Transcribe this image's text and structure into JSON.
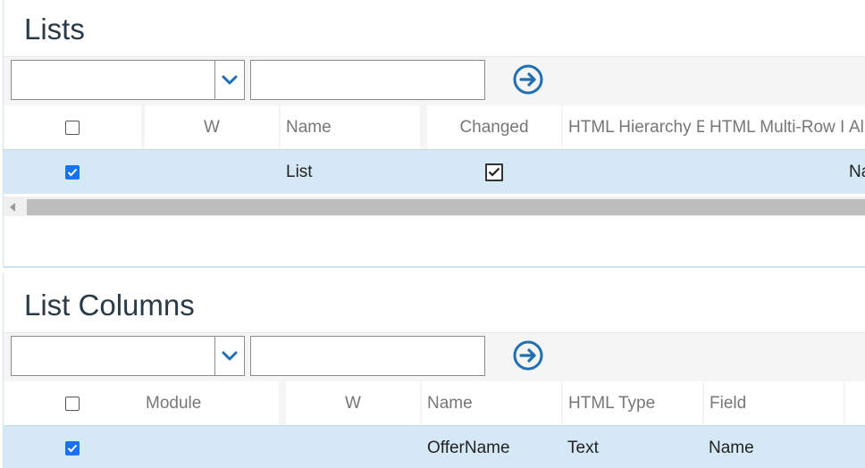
{
  "lists": {
    "title": "Lists",
    "search_placeholder": "",
    "columns": [
      "W",
      "Name",
      "Changed",
      "HTML Hierarchy E",
      "HTML Multi-Row I",
      "Alp"
    ],
    "rows": [
      {
        "selected": true,
        "w": "",
        "name": "List",
        "changed": true,
        "hierarchy": "",
        "multirow": "",
        "alp": "Na"
      }
    ]
  },
  "list_columns": {
    "title": "List Columns",
    "search_placeholder": "",
    "columns": [
      "Module",
      "W",
      "Name",
      "HTML Type",
      "Field"
    ],
    "rows": [
      {
        "selected": true,
        "module": "",
        "w": "",
        "name": "OfferName",
        "html_type": "Text",
        "field": "Name"
      }
    ]
  },
  "colors": {
    "accent": "#1a73e8",
    "selected_row": "#d5e8f6",
    "go_button": "#1f6fb5"
  },
  "icons": {
    "dropdown": "chevron-down-icon",
    "go": "arrow-right-circle-icon",
    "scroll_left": "triangle-left-icon"
  }
}
